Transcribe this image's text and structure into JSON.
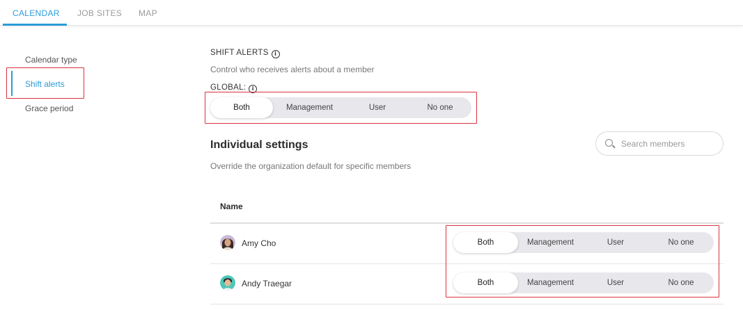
{
  "tabs": [
    {
      "label": "CALENDAR",
      "active": true
    },
    {
      "label": "JOB SITES",
      "active": false
    },
    {
      "label": "MAP",
      "active": false
    }
  ],
  "sidebar": {
    "items": [
      {
        "label": "Calendar type",
        "active": false
      },
      {
        "label": "Shift alerts",
        "active": true
      },
      {
        "label": "Grace period",
        "active": false
      }
    ]
  },
  "shift_alerts": {
    "title": "SHIFT ALERTS",
    "description": "Control who receives alerts about a member",
    "global_label": "GLOBAL:",
    "global_options": [
      "Both",
      "Management",
      "User",
      "No one"
    ],
    "global_selected": "Both"
  },
  "individual": {
    "heading": "Individual settings",
    "description": "Override the organization default for specific members",
    "search_placeholder": "Search members",
    "column_name": "Name",
    "members": [
      {
        "name": "Amy Cho",
        "options": [
          "Both",
          "Management",
          "User",
          "No one"
        ],
        "selected": "Both"
      },
      {
        "name": "Andy Traegar",
        "options": [
          "Both",
          "Management",
          "User",
          "No one"
        ],
        "selected": "Both"
      }
    ]
  },
  "colors": {
    "accent": "#2a9bd8",
    "highlight": "#d9323d",
    "segment_bg": "#e8e8ec"
  },
  "icons": {
    "info": "info-icon",
    "search": "search-icon"
  }
}
